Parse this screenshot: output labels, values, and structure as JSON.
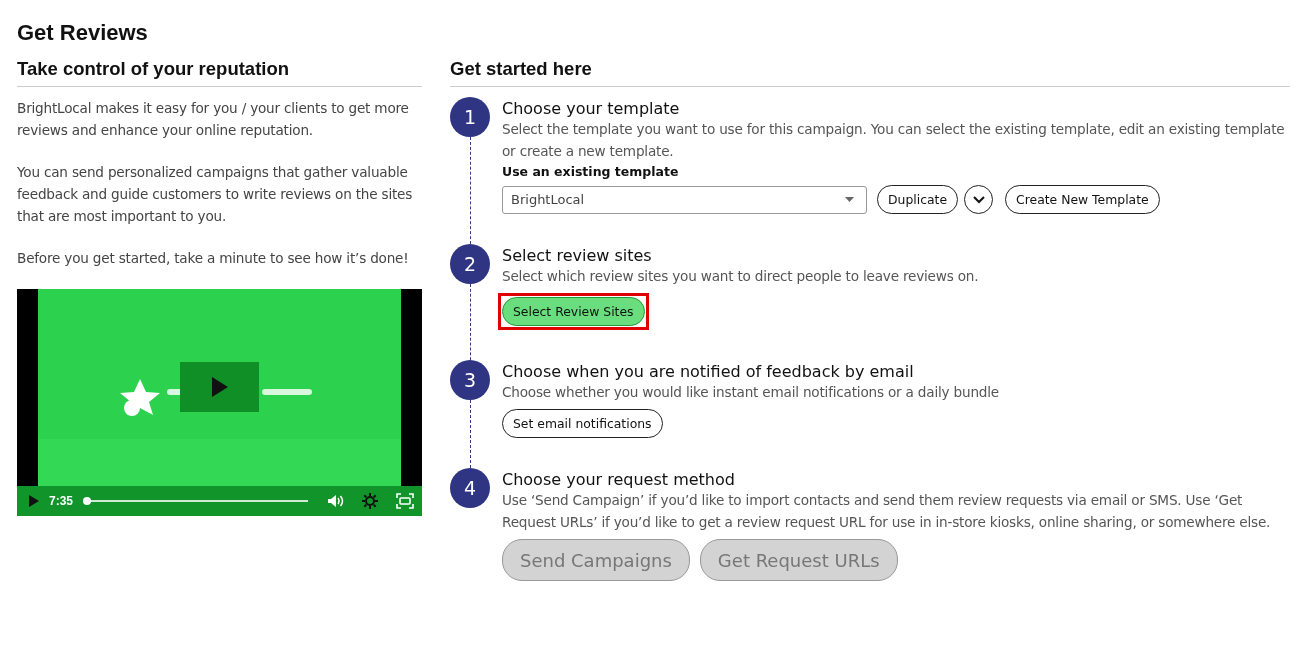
{
  "title": "Get Reviews",
  "intro": {
    "heading": "Take control of your reputation",
    "paragraphs": [
      "BrightLocal makes it easy for you / your clients to get more reviews and enhance your online reputation.",
      "You can send personalized campaigns that gather valuable feedback and guide customers to write reviews on the sites that are most important to you.",
      "Before you get started, take a minute to see how it’s done!"
    ],
    "video": {
      "time": "7:35",
      "level": 0.0
    }
  },
  "steps": {
    "heading": "Get started here",
    "items": [
      {
        "number": "1",
        "title": "Choose your template",
        "description": "Select the template you want to use for this campaign. You can select the existing template, edit an existing template or create a new template.",
        "field_label": "Use an existing template",
        "controls": [
          {
            "kind": "select",
            "value": "BrightLocal"
          },
          {
            "kind": "button",
            "label": "Duplicate",
            "disabled": false,
            "highlighted": false
          },
          {
            "kind": "menu"
          },
          {
            "kind": "button",
            "label": "Create New Template",
            "disabled": false,
            "highlighted": false
          }
        ]
      },
      {
        "number": "2",
        "title": "Select review sites",
        "description": "Select which review sites you want to direct people to leave reviews on.",
        "controls": [
          {
            "kind": "button",
            "label": "Select Review Sites",
            "disabled": false,
            "highlighted": true
          }
        ]
      },
      {
        "number": "3",
        "title": "Choose when you are notified of feedback by email",
        "description": "Choose whether you would like instant email notifications or a daily bundle",
        "controls": [
          {
            "kind": "button",
            "label": "Set email notifications",
            "disabled": false,
            "highlighted": false
          }
        ]
      },
      {
        "number": "4",
        "title": "Choose your request method",
        "description": "Use ‘Send Campaign’ if you’d like to import contacts and send them review requests via email or SMS. Use ‘Get Request URLs’ if you’d like to get a review request URL for use in in-store kiosks, online sharing, or somewhere else.",
        "controls": [
          {
            "kind": "large_button",
            "label": "Send Campaigns",
            "disabled": true,
            "highlighted": false
          },
          {
            "kind": "large_button",
            "label": "Get Request URLs",
            "disabled": true,
            "highlighted": false
          }
        ]
      }
    ]
  }
}
